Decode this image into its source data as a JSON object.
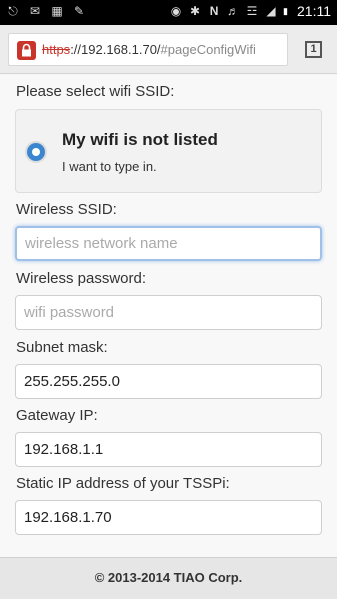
{
  "status_bar": {
    "time": "21:11",
    "battery": "▮",
    "icons": [
      "usb-icon",
      "mail-icon",
      "app-icon",
      "edit-icon",
      "eye-icon",
      "bluetooth-icon",
      "nfc-icon",
      "mute-icon",
      "wifi-icon",
      "signal-icon",
      "battery-icon"
    ]
  },
  "browser": {
    "url_protocol": "https",
    "url_host": "://192.168.1.70/",
    "url_path": "#pageConfigWifi",
    "tab_count": "1"
  },
  "form": {
    "ssid_prompt": "Please select wifi SSID:",
    "option_title": "My wifi is not listed",
    "option_subtitle": "I want to type in.",
    "ssid_label": "Wireless SSID:",
    "ssid_placeholder": "wireless network name",
    "ssid_value": "",
    "password_label": "Wireless password:",
    "password_placeholder": "wifi password",
    "password_value": "",
    "subnet_label": "Subnet mask:",
    "subnet_value": "255.255.255.0",
    "gateway_label": "Gateway IP:",
    "gateway_value": "192.168.1.1",
    "static_ip_label": "Static IP address of your TSSPi:",
    "static_ip_value": "192.168.1.70"
  },
  "footer": {
    "copyright": "© 2013-2014 TIAO Corp."
  }
}
